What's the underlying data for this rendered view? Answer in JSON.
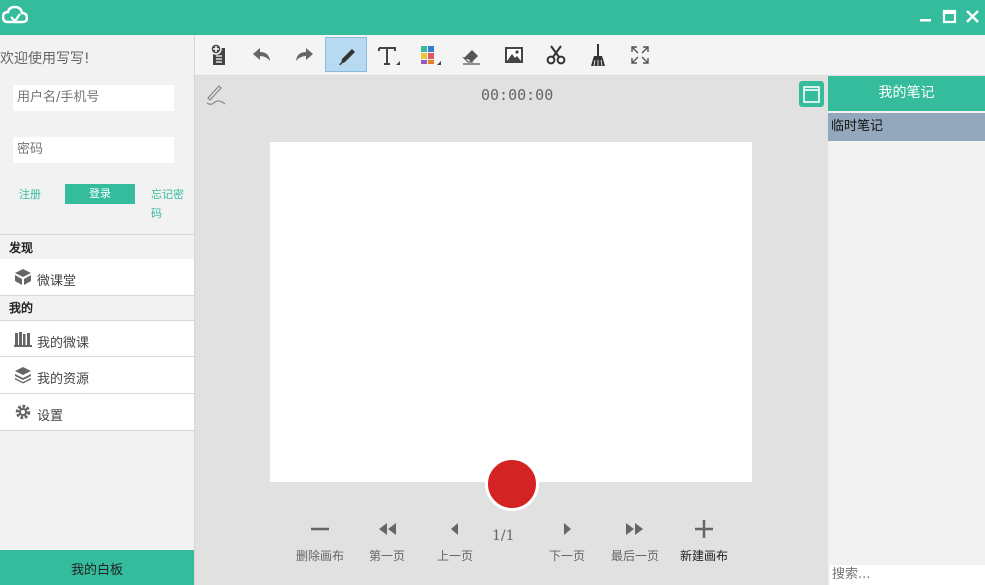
{
  "sidebar": {
    "welcome": "欢迎使用写写!",
    "username_placeholder": "用户名/手机号",
    "password_placeholder": "密码",
    "register_label": "注册",
    "login_label": "登录",
    "forgot_label": "忘记密码",
    "discover_title": "发现",
    "discover_items": [
      {
        "label": "微课堂",
        "icon": "box-icon"
      }
    ],
    "mine_title": "我的",
    "mine_items": [
      {
        "label": "我的微课",
        "icon": "bookshelf-icon"
      },
      {
        "label": "我的资源",
        "icon": "layers-icon"
      },
      {
        "label": "设置",
        "icon": "gear-icon"
      }
    ],
    "whiteboard_label": "我的白板"
  },
  "toolbar": {
    "tools": [
      "new-page-icon",
      "undo-icon",
      "redo-icon",
      "pen-icon",
      "text-icon",
      "color-icon",
      "eraser-icon",
      "image-icon",
      "scissors-icon",
      "broom-icon",
      "fullscreen-icon"
    ],
    "active_tool": "pen-icon"
  },
  "canvas": {
    "timer": "00:00:00",
    "page_indicator": "1/1",
    "controls": {
      "delete": "删除画布",
      "first": "第一页",
      "prev": "上一页",
      "next": "下一页",
      "last": "最后一页",
      "new": "新建画布"
    }
  },
  "notes": {
    "title": "我的笔记",
    "items": [
      "临时笔记"
    ],
    "search_placeholder": "搜索..."
  },
  "colors": {
    "accent": "#34bc9c",
    "record": "#d42323",
    "selected_note": "#94a8bd"
  }
}
